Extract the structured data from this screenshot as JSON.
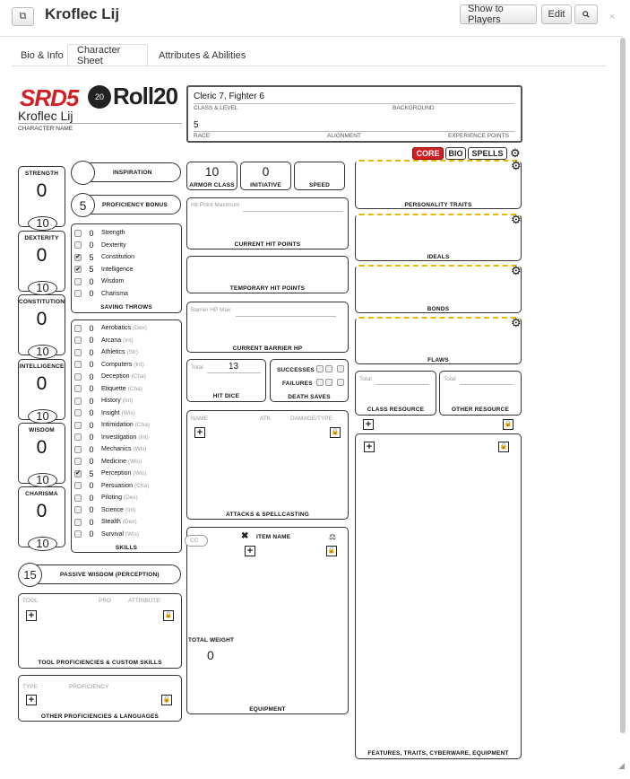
{
  "header": {
    "title": "Kroflec Lij",
    "show_players": "Show to Players",
    "edit": "Edit",
    "close": "×"
  },
  "tabs": [
    "Bio & Info",
    "Character Sheet",
    "Attributes & Abilities"
  ],
  "logo": {
    "srd": "SRD5",
    "d20": "20",
    "roll": "Roll20"
  },
  "character": {
    "name": "Kroflec Lij",
    "name_label": "CHARACTER NAME",
    "class_level": "Cleric 7, Fighter 6",
    "class_level_label": "CLASS & LEVEL",
    "background_label": "BACKGROUND",
    "race": "5",
    "race_label": "RACE",
    "alignment_label": "ALIGNMENT",
    "xp_label": "EXPERIENCE POINTS"
  },
  "sheet_buttons": {
    "core": "CORE",
    "bio": "BIO",
    "spells": "SPELLS"
  },
  "abilities": [
    {
      "name": "STRENGTH",
      "score": "0",
      "mod": "10"
    },
    {
      "name": "DEXTERITY",
      "score": "0",
      "mod": "10"
    },
    {
      "name": "CONSTITUTION",
      "score": "0",
      "mod": "10"
    },
    {
      "name": "INTELLIGENCE",
      "score": "0",
      "mod": "10"
    },
    {
      "name": "WISDOM",
      "score": "0",
      "mod": "10"
    },
    {
      "name": "CHARISMA",
      "score": "0",
      "mod": "10"
    }
  ],
  "inspiration_label": "INSPIRATION",
  "proficiency": {
    "value": "5",
    "label": "PROFICIENCY BONUS"
  },
  "saving_throws": {
    "label": "SAVING THROWS",
    "items": [
      {
        "name": "Strength",
        "value": "0",
        "checked": false
      },
      {
        "name": "Dexterity",
        "value": "0",
        "checked": false
      },
      {
        "name": "Constitution",
        "value": "5",
        "checked": true
      },
      {
        "name": "Intelligence",
        "value": "5",
        "checked": true
      },
      {
        "name": "Wisdom",
        "value": "0",
        "checked": false
      },
      {
        "name": "Charisma",
        "value": "0",
        "checked": false
      }
    ]
  },
  "skills": {
    "label": "SKILLS",
    "items": [
      {
        "name": "Aerobatics",
        "attr": "(Dex)",
        "value": "0",
        "checked": false
      },
      {
        "name": "Arcana",
        "attr": "(Int)",
        "value": "0",
        "checked": false
      },
      {
        "name": "Athletics",
        "attr": "(Str)",
        "value": "0",
        "checked": false
      },
      {
        "name": "Computers",
        "attr": "(Int)",
        "value": "0",
        "checked": false
      },
      {
        "name": "Deception",
        "attr": "(Cha)",
        "value": "0",
        "checked": false
      },
      {
        "name": "Etiquette",
        "attr": "(Cha)",
        "value": "0",
        "checked": false
      },
      {
        "name": "History",
        "attr": "(Int)",
        "value": "0",
        "checked": false
      },
      {
        "name": "Insight",
        "attr": "(Wis)",
        "value": "0",
        "checked": false
      },
      {
        "name": "Intimidation",
        "attr": "(Cha)",
        "value": "0",
        "checked": false
      },
      {
        "name": "Investigation",
        "attr": "(Int)",
        "value": "0",
        "checked": false
      },
      {
        "name": "Mechanics",
        "attr": "(Wis)",
        "value": "0",
        "checked": false
      },
      {
        "name": "Medicine",
        "attr": "(Wis)",
        "value": "0",
        "checked": false
      },
      {
        "name": "Perception",
        "attr": "(Wis)",
        "value": "5",
        "checked": true
      },
      {
        "name": "Persuasion",
        "attr": "(Cha)",
        "value": "0",
        "checked": false
      },
      {
        "name": "Piloting",
        "attr": "(Dex)",
        "value": "0",
        "checked": false
      },
      {
        "name": "Science",
        "attr": "(Int)",
        "value": "0",
        "checked": false
      },
      {
        "name": "Stealth",
        "attr": "(Dex)",
        "value": "0",
        "checked": false
      },
      {
        "name": "Survival",
        "attr": "(Wis)",
        "value": "0",
        "checked": false
      }
    ]
  },
  "passive": {
    "value": "15",
    "label": "PASSIVE WISDOM (PERCEPTION)"
  },
  "tools": {
    "col_tool": "TOOL",
    "col_pro": "PRO",
    "col_attr": "ATTRIBUTE",
    "label": "TOOL PROFICIENCIES & CUSTOM SKILLS"
  },
  "other_prof": {
    "col_type": "TYPE",
    "col_prof": "PROFICIENCY",
    "label": "OTHER PROFICIENCIES & LANGUAGES"
  },
  "combat": {
    "ac": "10",
    "ac_label": "ARMOR CLASS",
    "init": "0",
    "init_label": "INITIATIVE",
    "speed_label": "SPEED",
    "hp_max_placeholder": "Hit Point Maximum",
    "hp_label": "CURRENT HIT POINTS",
    "temp_hp_label": "TEMPORARY HIT POINTS",
    "barrier_max_placeholder": "Barrier HP Max",
    "barrier_label": "CURRENT BARRIER HP",
    "hd_total_placeholder": "Total",
    "hd_total": "13",
    "hd_label": "HIT DICE",
    "successes": "SUCCESSES",
    "failures": "FAILURES",
    "death_label": "DEATH SAVES"
  },
  "attacks": {
    "col_name": "NAME",
    "col_atk": "ATK",
    "col_dmg": "DAMAGE/TYPE",
    "label": "ATTACKS & SPELLCASTING"
  },
  "equipment": {
    "cc_placeholder": "CC",
    "item_name": "ITEM NAME",
    "total_weight_label": "TOTAL WEIGHT",
    "total_weight": "0",
    "label": "EQUIPMENT"
  },
  "traits": {
    "personality": "PERSONALITY TRAITS",
    "ideals": "IDEALS",
    "bonds": "BONDS",
    "flaws": "FLAWS"
  },
  "resources": {
    "total_placeholder": "Total",
    "class_label": "CLASS RESOURCE",
    "other_label": "OTHER RESOURCE"
  },
  "features_label": "FEATURES, TRAITS, CYBERWARE, EQUIPMENT"
}
